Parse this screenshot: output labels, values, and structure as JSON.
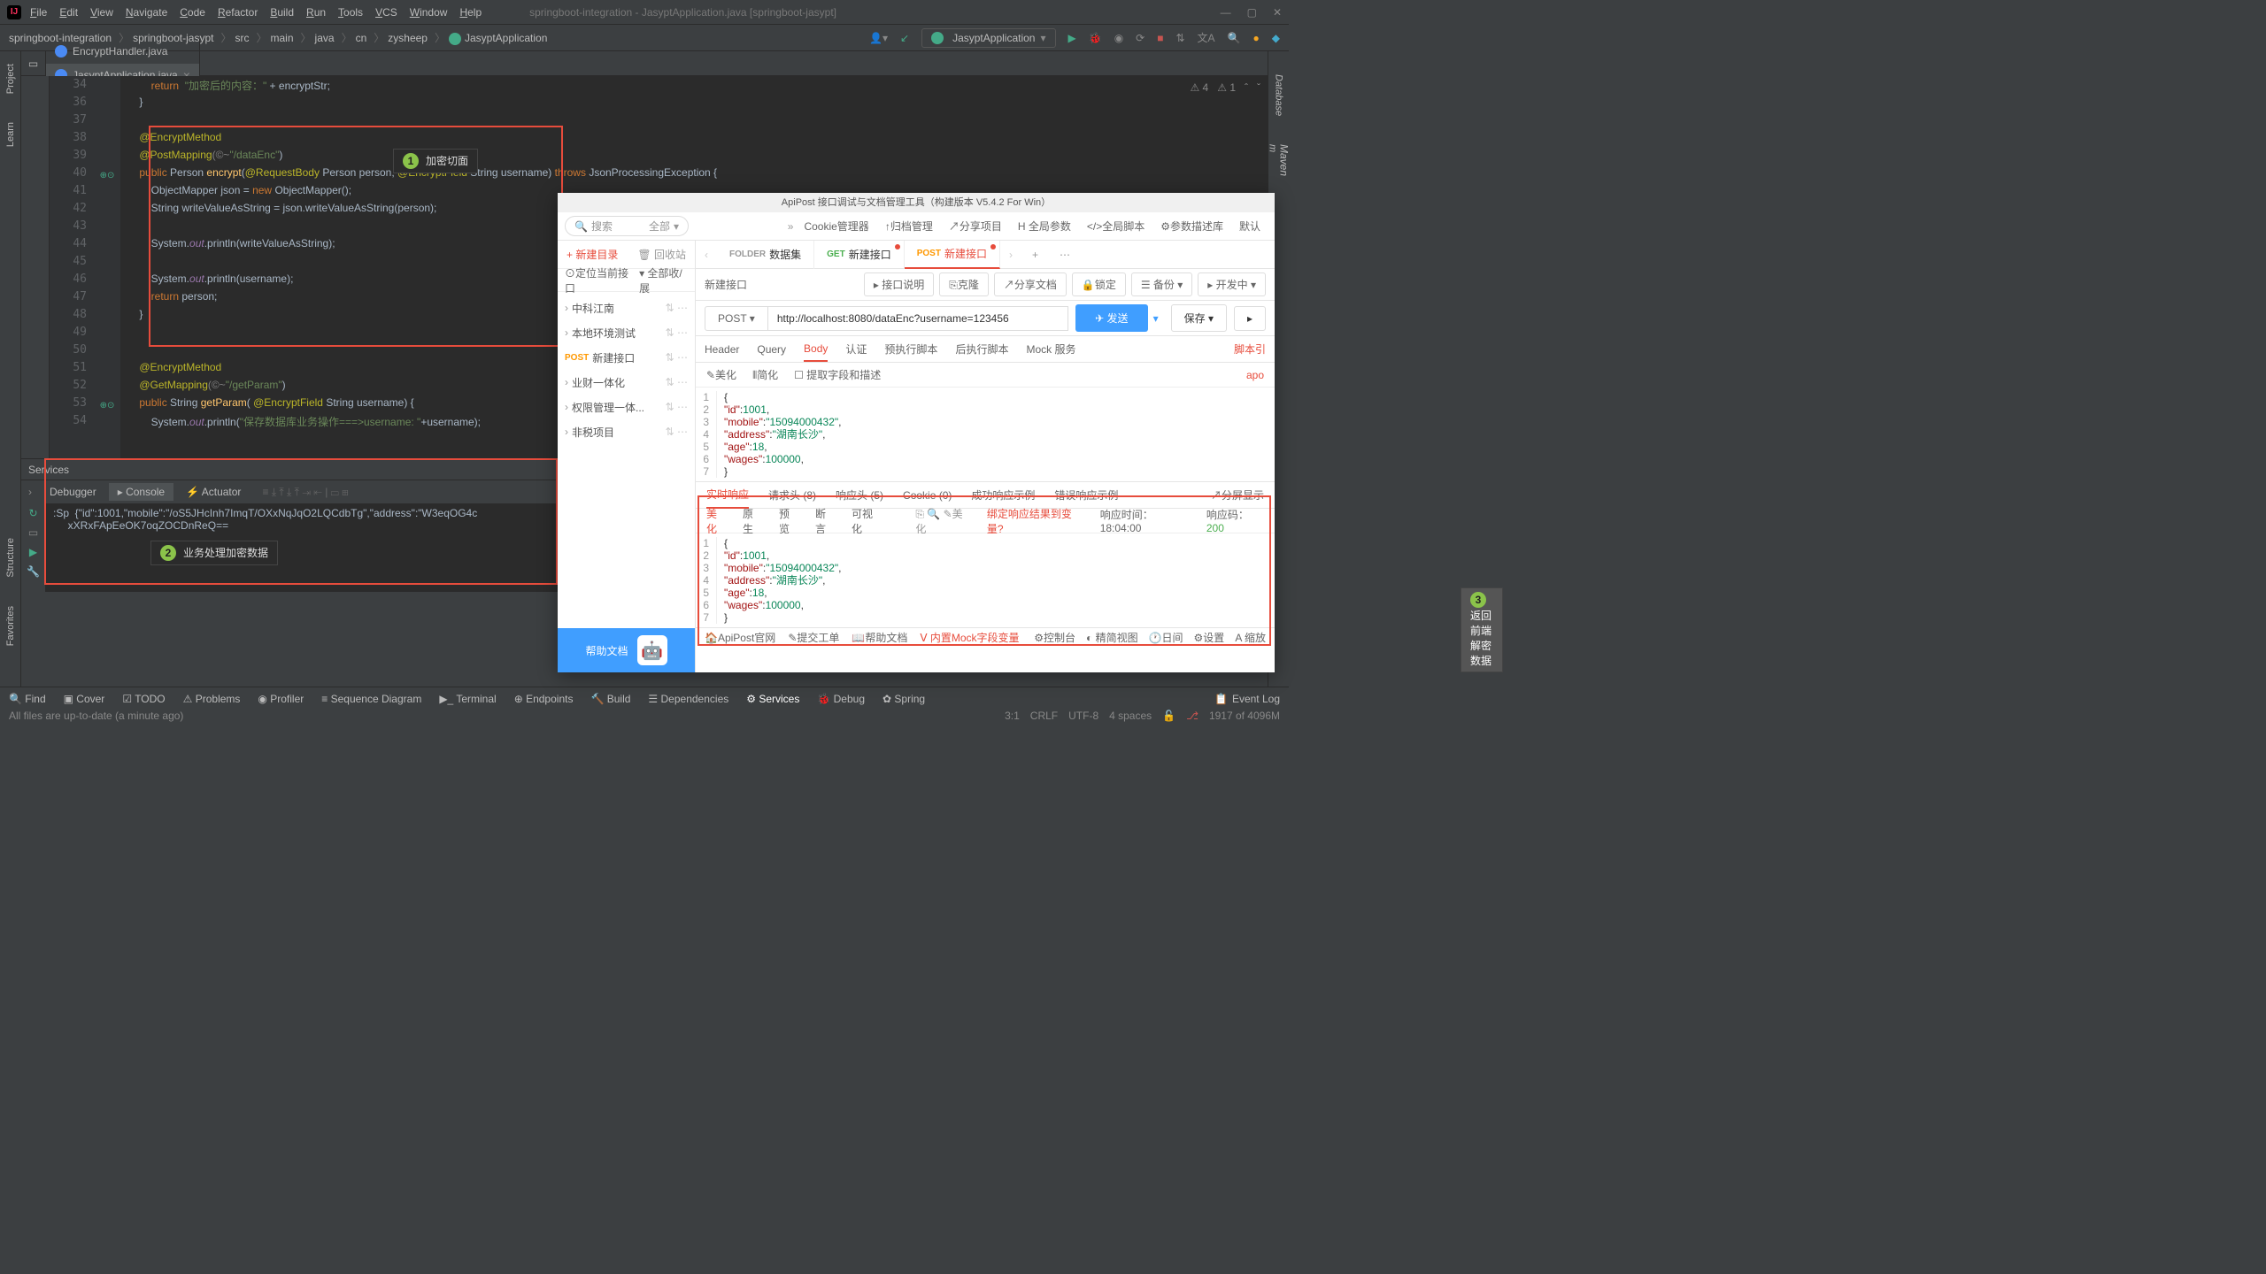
{
  "window": {
    "title": "springboot-integration - JasyptApplication.java [springboot-jasypt]"
  },
  "menu": [
    "File",
    "Edit",
    "View",
    "Navigate",
    "Code",
    "Refactor",
    "Build",
    "Run",
    "Tools",
    "VCS",
    "Window",
    "Help"
  ],
  "breadcrumbs": [
    "springboot-integration",
    "springboot-jasypt",
    "src",
    "main",
    "java",
    "cn",
    "zysheep",
    "JasyptApplication"
  ],
  "runConfig": "JasyptApplication",
  "leftTabs": [
    "Project",
    "Learn",
    "Structure",
    "Favorites"
  ],
  "rightTabs": [
    "Database",
    "Maven"
  ],
  "editorTabs": [
    {
      "name": "EncryptHandler.java",
      "active": false
    },
    {
      "name": "JasyptApplication.java",
      "active": true
    }
  ],
  "warnings": {
    "errors": "4",
    "warnings": "1"
  },
  "lines": [
    {
      "n": "34",
      "code": "        return  \"加密后的内容：\" + encryptStr;",
      "seg": [
        {
          "t": "        ",
          "c": ""
        },
        {
          "t": "return  ",
          "c": "kw"
        },
        {
          "t": "\"加密后的内容：\"",
          "c": "str"
        },
        {
          "t": " + encryptStr;",
          "c": ""
        }
      ]
    },
    {
      "n": "36",
      "code": "    }",
      "seg": [
        {
          "t": "    }",
          "c": ""
        }
      ]
    },
    {
      "n": "37",
      "code": "",
      "seg": []
    },
    {
      "n": "38",
      "code": "    @EncryptMethod",
      "seg": [
        {
          "t": "    ",
          "c": ""
        },
        {
          "t": "@EncryptMethod",
          "c": "ann"
        }
      ]
    },
    {
      "n": "39",
      "code": "    @PostMapping(\"/dataEnc\")",
      "seg": [
        {
          "t": "    ",
          "c": ""
        },
        {
          "t": "@PostMapping",
          "c": "ann"
        },
        {
          "t": "(©~",
          "c": "cmt"
        },
        {
          "t": "\"/dataEnc\"",
          "c": "str"
        },
        {
          "t": ")",
          "c": ""
        }
      ]
    },
    {
      "n": "40",
      "code": "    public Person encrypt(@RequestBody Person person, @EncryptField String username) throws JsonProcessingException {",
      "seg": [
        {
          "t": "    ",
          "c": ""
        },
        {
          "t": "public ",
          "c": "kw"
        },
        {
          "t": "Person ",
          "c": ""
        },
        {
          "t": "encrypt",
          "c": "mth"
        },
        {
          "t": "(",
          "c": ""
        },
        {
          "t": "@RequestBody ",
          "c": "ann"
        },
        {
          "t": "Person person, ",
          "c": ""
        },
        {
          "t": "@EncryptField ",
          "c": "ann"
        },
        {
          "t": "String username) ",
          "c": ""
        },
        {
          "t": "throws ",
          "c": "kw"
        },
        {
          "t": "JsonProcessingException {",
          "c": ""
        }
      ]
    },
    {
      "n": "41",
      "code": "        ObjectMapper json = new ObjectMapper();",
      "seg": [
        {
          "t": "        ObjectMapper json = ",
          "c": ""
        },
        {
          "t": "new ",
          "c": "kw"
        },
        {
          "t": "ObjectMapper();",
          "c": ""
        }
      ]
    },
    {
      "n": "42",
      "code": "        String writeValueAsString = json.writeValueAsString(person);",
      "seg": [
        {
          "t": "        String writeValueAsString = json.writeValueAsString(person);",
          "c": ""
        }
      ]
    },
    {
      "n": "43",
      "code": "",
      "seg": []
    },
    {
      "n": "44",
      "code": "        System.out.println(writeValueAsString);",
      "seg": [
        {
          "t": "        System.",
          "c": ""
        },
        {
          "t": "out",
          "c": "fld"
        },
        {
          "t": ".println(writeValueAsString);",
          "c": ""
        }
      ]
    },
    {
      "n": "45",
      "code": "",
      "seg": []
    },
    {
      "n": "46",
      "code": "        System.out.println(username);",
      "seg": [
        {
          "t": "        System.",
          "c": ""
        },
        {
          "t": "out",
          "c": "fld"
        },
        {
          "t": ".println(username);",
          "c": ""
        }
      ]
    },
    {
      "n": "47",
      "code": "        return person;",
      "seg": [
        {
          "t": "        ",
          "c": ""
        },
        {
          "t": "return ",
          "c": "kw"
        },
        {
          "t": "person;",
          "c": ""
        }
      ]
    },
    {
      "n": "48",
      "code": "    }",
      "seg": [
        {
          "t": "    }",
          "c": ""
        }
      ]
    },
    {
      "n": "49",
      "code": "",
      "seg": []
    },
    {
      "n": "50",
      "code": "",
      "seg": []
    },
    {
      "n": "51",
      "code": "    @EncryptMethod",
      "seg": [
        {
          "t": "    ",
          "c": ""
        },
        {
          "t": "@EncryptMethod",
          "c": "ann"
        }
      ]
    },
    {
      "n": "52",
      "code": "    @GetMapping(\"/getParam\")",
      "seg": [
        {
          "t": "    ",
          "c": ""
        },
        {
          "t": "@GetMapping",
          "c": "ann"
        },
        {
          "t": "(©~",
          "c": "cmt"
        },
        {
          "t": "\"/getParam\"",
          "c": "str"
        },
        {
          "t": ")",
          "c": ""
        }
      ]
    },
    {
      "n": "53",
      "code": "    public String getParam( @EncryptField String username) {",
      "seg": [
        {
          "t": "    ",
          "c": ""
        },
        {
          "t": "public ",
          "c": "kw"
        },
        {
          "t": "String ",
          "c": ""
        },
        {
          "t": "getParam",
          "c": "mth"
        },
        {
          "t": "( ",
          "c": ""
        },
        {
          "t": "@EncryptField ",
          "c": "ann"
        },
        {
          "t": "String username) {",
          "c": ""
        }
      ]
    },
    {
      "n": "54",
      "code": "        System.out.println(\"保存数据库业务操作===>username: \"+username);",
      "seg": [
        {
          "t": "        System.",
          "c": ""
        },
        {
          "t": "out",
          "c": "fld"
        },
        {
          "t": ".println(",
          "c": ""
        },
        {
          "t": "\"保存数据库业务操作===>username: \"",
          "c": "str"
        },
        {
          "t": "+username);",
          "c": ""
        }
      ]
    }
  ],
  "callout1": "加密切面",
  "callout2": "业务处理加密数据",
  "callout3": "返回前端解密数据",
  "services": {
    "title": "Services",
    "tabs": [
      "Debugger",
      "Console",
      "Actuator"
    ],
    "console": ":Sp  {\"id\":1001,\"mobile\":\"/oS5JHcInh7ImqT/OXxNqJqO2LQCdbTg\",\"address\":\"W3eqOG4c\n     xXRxFApEeOK7oqZOCDnReQ=="
  },
  "bottomTabs": [
    "Find",
    "Cover",
    "TODO",
    "Problems",
    "Profiler",
    "Sequence Diagram",
    "Terminal",
    "Endpoints",
    "Build",
    "Dependencies",
    "Services",
    "Debug",
    "Spring"
  ],
  "bottomRight": "Event Log",
  "status": {
    "left": "All files are up-to-date (a minute ago)",
    "pos": "3:1",
    "enc": "CRLF",
    "charset": "UTF-8",
    "indent": "4 spaces",
    "mem": "1917 of 4096M"
  },
  "apipost": {
    "title": "ApiPost 接口调试与文档管理工具（构建版本 V5.4.2 For Win）",
    "search": "搜索",
    "searchAll": "全部",
    "topbtns": [
      "Cookie管理器",
      "↑归档管理",
      "↗分享项目",
      "H 全局参数",
      "</>全局脚本",
      "⚙参数描述库",
      "默认"
    ],
    "newFolder": "新建目录",
    "recycle": "回收站",
    "locate": "定位当前接口",
    "expand": "全部收/展",
    "tree": [
      {
        "label": "中科江南",
        "arr": "›"
      },
      {
        "label": "本地环境测试",
        "arr": "›"
      },
      {
        "label": "新建接口",
        "method": "POST"
      },
      {
        "label": "业财一体化",
        "arr": "›"
      },
      {
        "label": "权限管理一体...",
        "arr": "›"
      },
      {
        "label": "非税项目",
        "arr": "›"
      }
    ],
    "help": "帮助文档",
    "reqTabs": [
      {
        "m": "FOLDER",
        "label": "数据集"
      },
      {
        "m": "GET",
        "label": "新建接口",
        "dot": true
      },
      {
        "m": "POST",
        "label": "新建接口",
        "dot": true,
        "active": true
      }
    ],
    "reqName": "新建接口",
    "actions": [
      "▸ 接口说明",
      "⎘克隆",
      "↗分享文档",
      "🔒锁定",
      "☰ 备份 ▾",
      "▸ 开发中 ▾"
    ],
    "method": "POST",
    "url": "http://localhost:8080/dataEnc?username=123456",
    "send": "发送",
    "save": "保存",
    "qtabs": [
      "Header",
      "Query",
      "Body",
      "认证",
      "预执行脚本",
      "后执行脚本",
      "Mock 服务"
    ],
    "qactive": "Body",
    "scriptRef": "脚本引",
    "subtool": [
      "✎美化",
      "⫴简化",
      "☐ 提取字段和描述"
    ],
    "apo": "apo",
    "body": [
      {
        "n": "1",
        "t": "{"
      },
      {
        "n": "2",
        "t": "    \"id\": 1001,",
        "k": "id",
        "v": "1001",
        "vt": "n"
      },
      {
        "n": "3",
        "t": "    \"mobile\": \"15094000432\",",
        "k": "mobile",
        "v": "\"15094000432\"",
        "vt": "s"
      },
      {
        "n": "4",
        "t": "    \"address\": \"湖南长沙\",",
        "k": "address",
        "v": "\"湖南长沙\"",
        "vt": "s"
      },
      {
        "n": "5",
        "t": "    \"age\": 18,",
        "k": "age",
        "v": "18",
        "vt": "n"
      },
      {
        "n": "6",
        "t": "    \"wages\": 100000",
        "k": "wages",
        "v": "100000",
        "vt": "n"
      },
      {
        "n": "7",
        "t": "}"
      }
    ],
    "respTabs": [
      "实时响应",
      "请求头 (8)",
      "响应头 (5)",
      "Cookie (0)",
      "成功响应示例",
      "错误响应示例"
    ],
    "respActive": "实时响应",
    "split": "↗分屏显示",
    "respSub": [
      "美化",
      "原生",
      "预览",
      "断言",
      "可视化"
    ],
    "respSubActive": "美化",
    "respExtras": {
      "bind": "绑定响应结果到变量?",
      "time": "响应时间：18:04:00",
      "code": "响应码：200"
    },
    "respBody": [
      {
        "n": "1",
        "t": "{"
      },
      {
        "n": "2",
        "t": "    \"id\": 1001,",
        "k": "id",
        "v": "1001",
        "vt": "n"
      },
      {
        "n": "3",
        "t": "    \"mobile\": \"15094000432\",",
        "k": "mobile",
        "v": "\"15094000432\"",
        "vt": "s"
      },
      {
        "n": "4",
        "t": "    \"address\": \"湖南长沙\",",
        "k": "address",
        "v": "\"湖南长沙\"",
        "vt": "s"
      },
      {
        "n": "5",
        "t": "    \"age\": 18,",
        "k": "age",
        "v": "18",
        "vt": "n"
      },
      {
        "n": "6",
        "t": "    \"wages\": 100000",
        "k": "wages",
        "v": "100000",
        "vt": "n"
      },
      {
        "n": "7",
        "t": "}"
      }
    ],
    "footer": [
      "🏠ApiPost官网",
      "✎提交工单",
      "📖帮助文档"
    ],
    "footerRed": "Ⅴ 内置Mock字段变量",
    "footerRight": [
      "⚙控制台",
      "◐ 精简视图",
      "🕐日间",
      "⚙设置",
      "A 缩放"
    ]
  }
}
